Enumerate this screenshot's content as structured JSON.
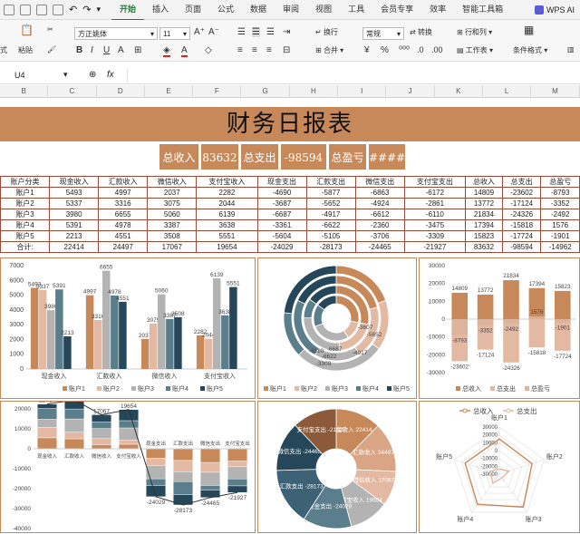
{
  "ribbon_tabs": [
    "开始",
    "插入",
    "页面",
    "公式",
    "数据",
    "审阅",
    "视图",
    "工具",
    "会员专享",
    "效率",
    "智能工具箱"
  ],
  "active_tab": "开始",
  "wps_label": "WPS AI",
  "ribbon": {
    "font_name": "方正姚体",
    "font_size": "11",
    "format": "常规",
    "convert": "转换",
    "row_col": "行和列",
    "worksheet": "工作表",
    "cond_format": "条件格式",
    "wrap": "换行",
    "merge": "合并",
    "left_label": "式",
    "paste": "粘贴"
  },
  "formula_bar": {
    "cell_ref": "U4",
    "fx": "fx"
  },
  "columns": [
    "B",
    "C",
    "D",
    "E",
    "F",
    "G",
    "H",
    "I",
    "J",
    "K",
    "L",
    "M"
  ],
  "title": "财务日报表",
  "summary": [
    "总收入",
    "83632",
    "总支出",
    "-98594",
    "总盈亏",
    "####"
  ],
  "table": {
    "headers": [
      "账户分类",
      "现金收入",
      "汇款收入",
      "微信收入",
      "支付宝收入",
      "现金支出",
      "汇款支出",
      "微信支出",
      "支付宝支出",
      "总收入",
      "总支出",
      "总盈亏"
    ],
    "rows": [
      [
        "账户1",
        "5493",
        "4997",
        "2037",
        "2282",
        "-4690",
        "-5877",
        "-6863",
        "-6172",
        "14809",
        "-23602",
        "-8793"
      ],
      [
        "账户2",
        "5337",
        "3316",
        "3075",
        "2044",
        "-3687",
        "-5652",
        "-4924",
        "-2861",
        "13772",
        "-17124",
        "-3352"
      ],
      [
        "账户3",
        "3980",
        "6655",
        "5060",
        "6139",
        "-6687",
        "-4917",
        "-6612",
        "-6110",
        "21834",
        "-24326",
        "-2492"
      ],
      [
        "账户4",
        "5391",
        "4978",
        "3387",
        "3638",
        "-3361",
        "-6622",
        "-2360",
        "-3475",
        "17394",
        "-15818",
        "1576"
      ],
      [
        "账户5",
        "2213",
        "4551",
        "3508",
        "5551",
        "-5604",
        "-5105",
        "-3706",
        "-3309",
        "15823",
        "-17724",
        "-1901"
      ],
      [
        "合计:",
        "22414",
        "24497",
        "17067",
        "19654",
        "-24029",
        "-28173",
        "-24465",
        "-21927",
        "83632",
        "-98594",
        "-14962"
      ]
    ]
  },
  "colors": {
    "accent": "#c8895a",
    "s1": "#c8895a",
    "s2": "#e3b9a3",
    "s3": "#b3b3b3",
    "s4": "#5b7e8c",
    "s5": "#26475a",
    "border": "#9a4a3a",
    "green": "#2a7a3c"
  },
  "chart_data": [
    {
      "type": "bar",
      "categories": [
        "现金收入",
        "汇款收入",
        "微信收入",
        "支付宝收入"
      ],
      "series": [
        {
          "name": "账户1",
          "values": [
            5493,
            4997,
            2037,
            2282
          ]
        },
        {
          "name": "账户2",
          "values": [
            5337,
            3316,
            3075,
            2044
          ]
        },
        {
          "name": "账户3",
          "values": [
            3980,
            6655,
            5060,
            6139
          ]
        },
        {
          "name": "账户4",
          "values": [
            5391,
            4978,
            3387,
            3638
          ]
        },
        {
          "name": "账户5",
          "values": [
            2213,
            4551,
            3508,
            5551
          ]
        }
      ],
      "ylim": [
        0,
        7000
      ],
      "y_ticks": [
        "0",
        "1000",
        "2000",
        "3000",
        "4000",
        "5000",
        "6000",
        "7000"
      ],
      "legend": "bottom"
    },
    {
      "type": "pie",
      "subtype": "nested-donut",
      "series": [
        "账户1",
        "账户2",
        "账户3",
        "账户4",
        "账户5"
      ],
      "legend": "bottom",
      "rings": [
        [
          -4690,
          -3687,
          -6687,
          -3361,
          -5604
        ],
        [
          -5877,
          -5652,
          -4917,
          -6622,
          -5105
        ],
        [
          -6863,
          -4924,
          -6612,
          -2360,
          -3706
        ],
        [
          -6172,
          -2861,
          -6110,
          -3475,
          -3309
        ]
      ],
      "labels": [
        "-3607",
        "-5652",
        "-4917",
        "-6687",
        "-6622",
        "-6110",
        "-3309"
      ]
    },
    {
      "type": "bar",
      "categories": [
        "账户1",
        "账户2",
        "账户3",
        "账户4",
        "账户5"
      ],
      "series": [
        {
          "name": "总收入",
          "values": [
            14809,
            13772,
            21834,
            17394,
            15823
          ]
        },
        {
          "name": "总支出",
          "values": [
            -23602,
            -17124,
            -24326,
            -15818,
            -17724
          ]
        },
        {
          "name": "总盈亏",
          "values": [
            -8793,
            -3352,
            -2492,
            1576,
            -1901
          ]
        }
      ],
      "ylim": [
        -30000,
        30000
      ],
      "y_ticks": [
        "30000",
        "20000",
        "10000",
        "0",
        "-10000",
        "-20000",
        "-30000"
      ],
      "legend": "bottom"
    },
    {
      "type": "bar",
      "subtype": "stacked-waterfall",
      "categories": [
        "现金收入",
        "汇款收入",
        "微信收入",
        "支付宝收入",
        "现金支出",
        "汇款支出",
        "微信支出",
        "支付宝支出"
      ],
      "totals": [
        22414,
        24497,
        17067,
        19654,
        -24029,
        -28173,
        -24465,
        -21927
      ],
      "labels": [
        "22414",
        "24497",
        "17067",
        "19654",
        "-24029",
        "-28173",
        "-24465",
        "-21927"
      ],
      "ylim": [
        -40000,
        20000
      ],
      "y_ticks": [
        "20000",
        "10000",
        "0",
        "-10000",
        "-20000",
        "-30000",
        "-40000"
      ]
    },
    {
      "type": "pie",
      "subtype": "donut",
      "categories": [
        "现金收入",
        "汇款收入",
        "微信收入",
        "支付宝收入",
        "现金支出",
        "汇款支出",
        "微信支出",
        "支付宝支出"
      ],
      "values": [
        22414,
        24497,
        17067,
        19654,
        24029,
        28173,
        24465,
        21927
      ],
      "labels": [
        "现金收入 22414",
        "汇款收入 24497",
        "微信收入 17067",
        "支付宝收入 19654",
        "现金支出 -24029",
        "汇款支出 -28173",
        "微信支出 -24465",
        "支付宝支出 -21927"
      ]
    },
    {
      "type": "radar",
      "categories": [
        "账户1",
        "账户2",
        "账户3",
        "账户4",
        "账户5"
      ],
      "series": [
        {
          "name": "总收入",
          "values": [
            14809,
            13772,
            21834,
            17394,
            15823
          ]
        },
        {
          "name": "总支出",
          "values": [
            -23602,
            -17124,
            -24326,
            -15818,
            -17724
          ]
        }
      ],
      "r_ticks": [
        "30000",
        "20000",
        "10000",
        "0",
        "-10000",
        "-20000",
        "-30000"
      ],
      "legend": "top"
    }
  ]
}
